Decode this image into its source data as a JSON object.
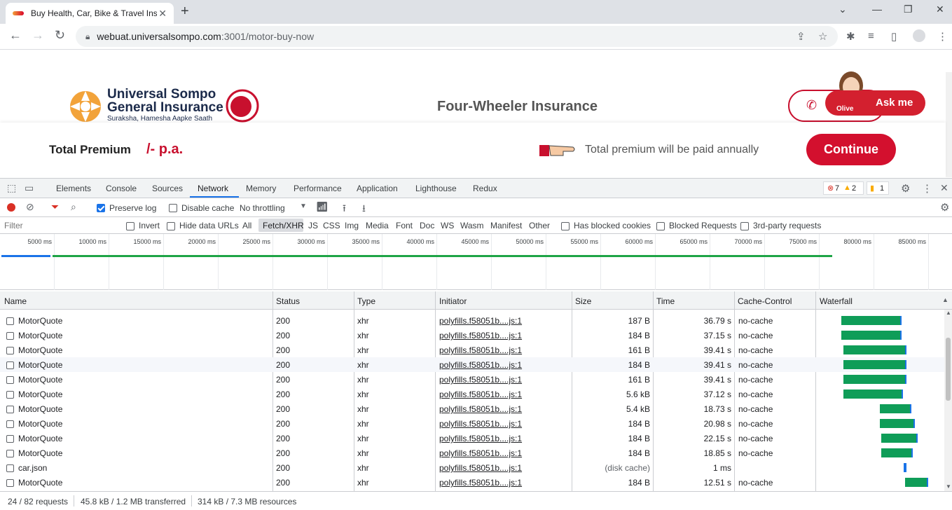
{
  "browser": {
    "tab_title": "Buy Health, Car, Bike & Travel Insurance",
    "url_host": "webuat.universalsompo.com",
    "url_path": ":3001/motor-buy-now"
  },
  "page": {
    "brand_line1": "Universal Sompo",
    "brand_line2": "General Insurance",
    "brand_tagline": "Suraksha, Hamesha Aapke Saath",
    "hero_title": "Four-Wheeler Insurance",
    "ask_label": "Ask me",
    "olive_label": "Olive",
    "total_premium_label": "Total Premium",
    "premium_value": "/- p.a.",
    "annual_note": "Total premium will be paid annually",
    "continue_label": "Continue"
  },
  "devtools": {
    "tabs": [
      "Elements",
      "Console",
      "Sources",
      "Network",
      "Memory",
      "Performance",
      "Application",
      "Lighthouse",
      "Redux"
    ],
    "active_tab": "Network",
    "errors_count": "7",
    "warnings_count": "2",
    "issues_count": "1",
    "preserve_log": "Preserve log",
    "disable_cache": "Disable cache",
    "throttling": "No throttling",
    "filter_placeholder": "Filter",
    "invert": "Invert",
    "hide_data_urls": "Hide data URLs",
    "type_filters": [
      "All",
      "Fetch/XHR",
      "JS",
      "CSS",
      "Img",
      "Media",
      "Font",
      "Doc",
      "WS",
      "Wasm",
      "Manifest",
      "Other"
    ],
    "active_type_filter": "Fetch/XHR",
    "has_blocked_cookies": "Has blocked cookies",
    "blocked_requests": "Blocked Requests",
    "third_party": "3rd-party requests",
    "timeline_ticks": [
      "5000 ms",
      "10000 ms",
      "15000 ms",
      "20000 ms",
      "25000 ms",
      "30000 ms",
      "35000 ms",
      "40000 ms",
      "45000 ms",
      "50000 ms",
      "55000 ms",
      "60000 ms",
      "65000 ms",
      "70000 ms",
      "75000 ms",
      "80000 ms",
      "85000 ms"
    ],
    "columns": [
      "Name",
      "Status",
      "Type",
      "Initiator",
      "Size",
      "Time",
      "Cache-Control",
      "Waterfall"
    ],
    "rows": [
      {
        "name": "MotorQuote",
        "status": "200",
        "type": "xhr",
        "initiator": "polyfills.f58051b....js:1",
        "size": "187 B",
        "time": "36.79 s",
        "cache": "no-cache",
        "wf_start": 0.18,
        "wf_len": 0.49
      },
      {
        "name": "MotorQuote",
        "status": "200",
        "type": "xhr",
        "initiator": "polyfills.f58051b....js:1",
        "size": "184 B",
        "time": "37.15 s",
        "cache": "no-cache",
        "wf_start": 0.18,
        "wf_len": 0.49
      },
      {
        "name": "MotorQuote",
        "status": "200",
        "type": "xhr",
        "initiator": "polyfills.f58051b....js:1",
        "size": "161 B",
        "time": "39.41 s",
        "cache": "no-cache",
        "wf_start": 0.2,
        "wf_len": 0.51
      },
      {
        "name": "MotorQuote",
        "status": "200",
        "type": "xhr",
        "initiator": "polyfills.f58051b....js:1",
        "size": "184 B",
        "time": "39.41 s",
        "cache": "no-cache",
        "wf_start": 0.2,
        "wf_len": 0.51
      },
      {
        "name": "MotorQuote",
        "status": "200",
        "type": "xhr",
        "initiator": "polyfills.f58051b....js:1",
        "size": "161 B",
        "time": "39.41 s",
        "cache": "no-cache",
        "wf_start": 0.2,
        "wf_len": 0.51
      },
      {
        "name": "MotorQuote",
        "status": "200",
        "type": "xhr",
        "initiator": "polyfills.f58051b....js:1",
        "size": "5.6 kB",
        "time": "37.12 s",
        "cache": "no-cache",
        "wf_start": 0.2,
        "wf_len": 0.48
      },
      {
        "name": "MotorQuote",
        "status": "200",
        "type": "xhr",
        "initiator": "polyfills.f58051b....js:1",
        "size": "5.4 kB",
        "time": "18.73 s",
        "cache": "no-cache",
        "wf_start": 0.5,
        "wf_len": 0.25
      },
      {
        "name": "MotorQuote",
        "status": "200",
        "type": "xhr",
        "initiator": "polyfills.f58051b....js:1",
        "size": "184 B",
        "time": "20.98 s",
        "cache": "no-cache",
        "wf_start": 0.5,
        "wf_len": 0.28
      },
      {
        "name": "MotorQuote",
        "status": "200",
        "type": "xhr",
        "initiator": "polyfills.f58051b....js:1",
        "size": "184 B",
        "time": "22.15 s",
        "cache": "no-cache",
        "wf_start": 0.51,
        "wf_len": 0.29
      },
      {
        "name": "MotorQuote",
        "status": "200",
        "type": "xhr",
        "initiator": "polyfills.f58051b....js:1",
        "size": "184 B",
        "time": "18.85 s",
        "cache": "no-cache",
        "wf_start": 0.51,
        "wf_len": 0.25
      },
      {
        "name": "car.json",
        "status": "200",
        "type": "xhr",
        "initiator": "polyfills.f58051b....js:1",
        "size": "(disk cache)",
        "time": "1 ms",
        "cache": "",
        "wf_start": 0.7,
        "wf_len": 0.01
      },
      {
        "name": "MotorQuote",
        "status": "200",
        "type": "xhr",
        "initiator": "polyfills.f58051b....js:1",
        "size": "184 B",
        "time": "12.51 s",
        "cache": "no-cache",
        "wf_start": 0.71,
        "wf_len": 0.18
      }
    ],
    "status_requests": "24 / 82 requests",
    "status_transferred": "45.8 kB / 1.2 MB transferred",
    "status_resources": "314 kB / 7.3 MB resources"
  },
  "colors": {
    "brand_red": "#d3102e",
    "waterfall_green": "#0f9d58"
  }
}
